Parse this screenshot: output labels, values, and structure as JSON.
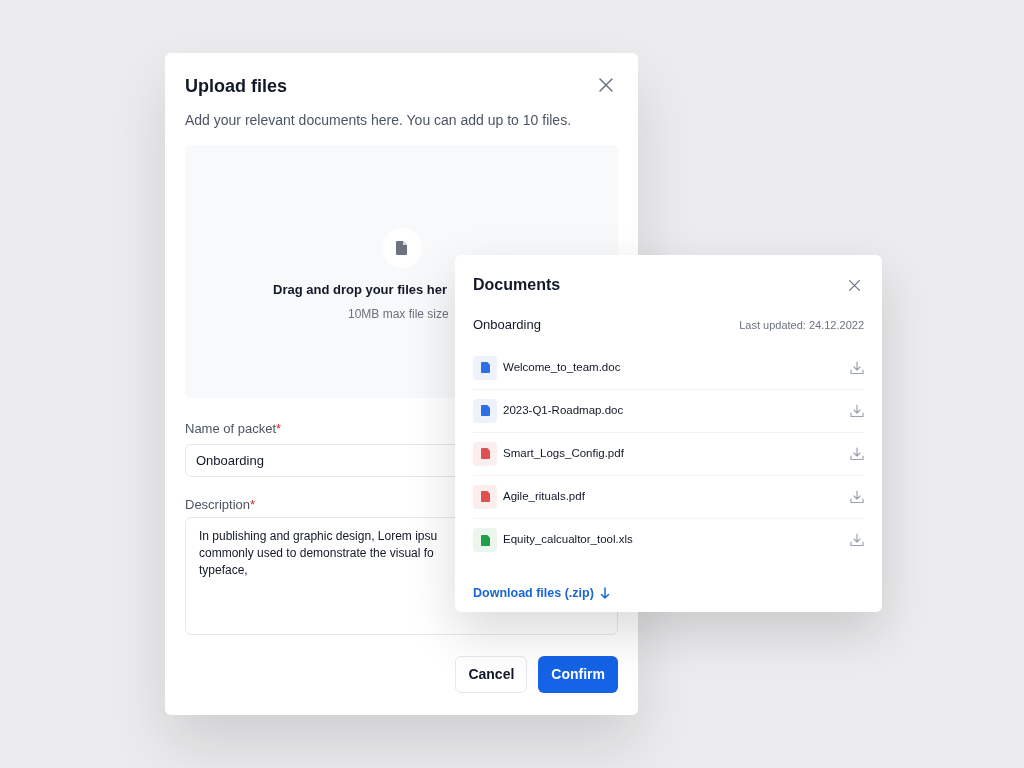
{
  "upload_dialog": {
    "title": "Upload files",
    "subtitle": "Add your relevant documents here. You can add up to 10 files.",
    "dropzone": {
      "text": "Drag and drop your files her",
      "hint": "10MB max file size"
    },
    "fields": [
      {
        "kind": "input",
        "label": "Name of packet",
        "required_mark": "*",
        "value": "Onboarding"
      },
      {
        "kind": "textarea",
        "label": "Description",
        "required_mark": "*",
        "lines": [
          "In publishing and graphic design, Lorem ipsu",
          "commonly used to demonstrate the visual fo",
          "typeface,"
        ]
      }
    ],
    "buttons": [
      {
        "kind": "secondary",
        "label": "Cancel"
      },
      {
        "kind": "primary",
        "label": "Confirm"
      }
    ]
  },
  "documents_panel": {
    "title": "Documents",
    "packet": "Onboarding",
    "updated": "Last updated: 24.12.2022",
    "files": [
      {
        "name": "Welcome_to_team.doc",
        "kind": "doc"
      },
      {
        "name": "2023-Q1-Roadmap.doc",
        "kind": "doc"
      },
      {
        "name": "Smart_Logs_Config.pdf",
        "kind": "pdf"
      },
      {
        "name": "Agile_rituals.pdf",
        "kind": "pdf"
      },
      {
        "name": "Equity_calcualtor_tool.xls",
        "kind": "xls"
      }
    ],
    "download_link": "Download files (.zip)"
  }
}
